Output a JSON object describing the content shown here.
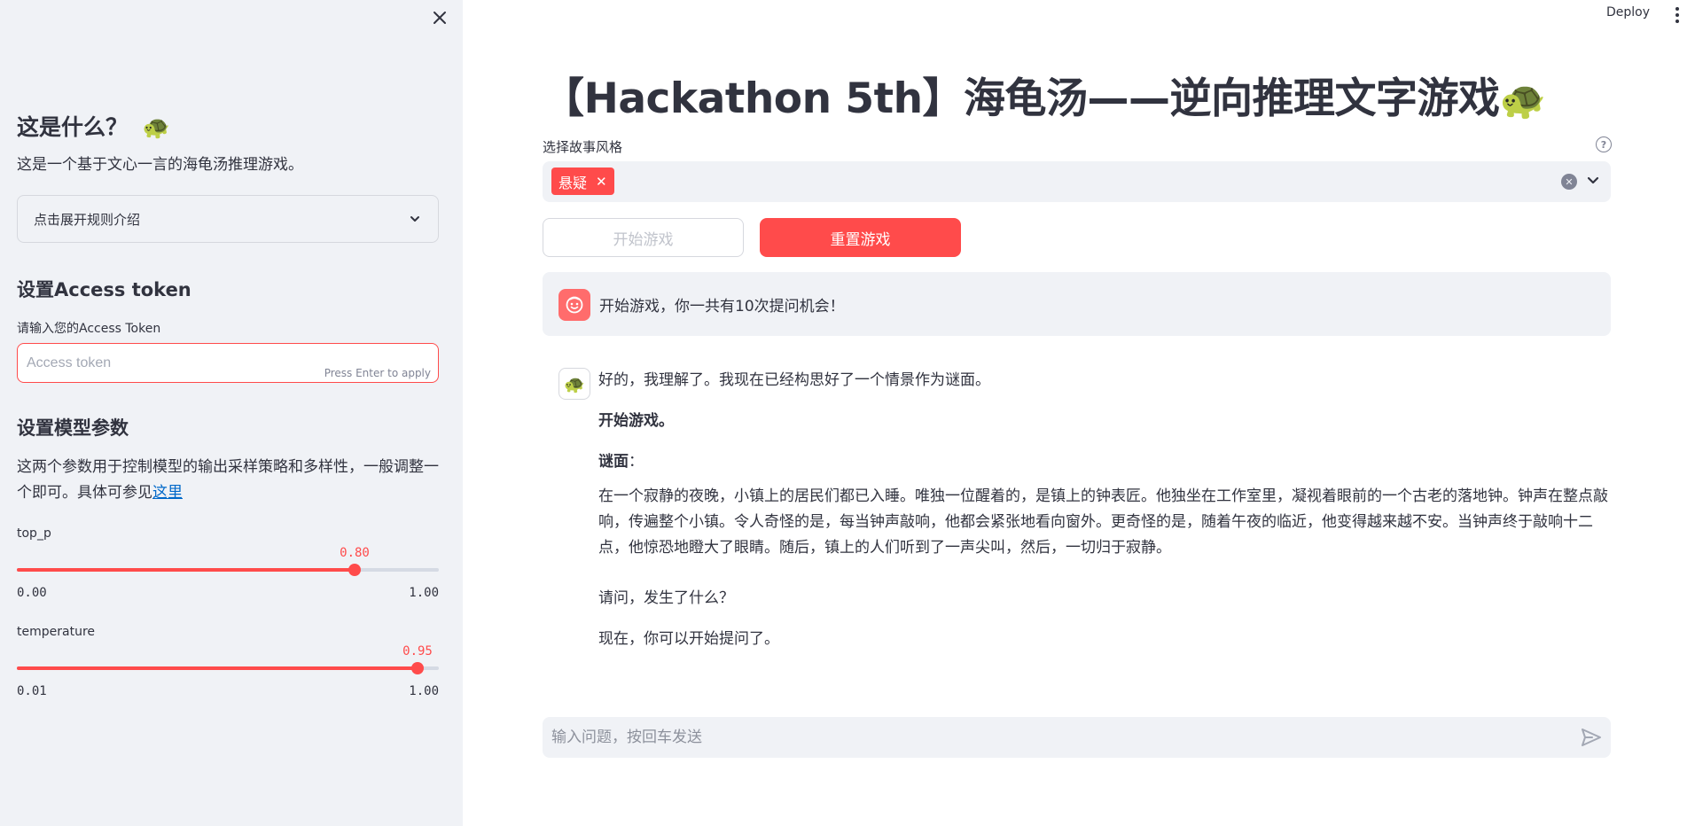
{
  "sidebar": {
    "what_title": "这是什么？",
    "what_emoji": "🐢",
    "what_desc": "这是一个基于文心一言的海龟汤推理游戏。",
    "rules_expander": "点击展开规则介绍",
    "token_heading": "设置Access token",
    "token_label": "请输入您的Access Token",
    "token_placeholder": "Access token",
    "token_value": "",
    "token_hint": "Press Enter to apply",
    "params_heading": "设置模型参数",
    "params_desc_1": "这两个参数用于控制模型的输出采样策略和多样性，一般调整一个即可。具体可参见",
    "params_link": "这里",
    "top_p": {
      "label": "top_p",
      "value": "0.80",
      "min": "0.00",
      "max": "1.00",
      "fraction": 0.8
    },
    "temperature": {
      "label": "temperature",
      "value": "0.95",
      "min": "0.01",
      "max": "1.00",
      "fraction": 0.9495
    }
  },
  "header": {
    "deploy_label": "Deploy",
    "menu_icon": "kebab-menu-icon"
  },
  "main": {
    "title": "【Hackathon 5th】海龟汤——逆向推理文字游戏",
    "title_emoji": "🐢",
    "style_select": {
      "label": "选择故事风格",
      "selected_tag": "悬疑",
      "tag_remove": "✕"
    },
    "start_button": "开始游戏",
    "reset_button": "重置游戏",
    "system_message": "开始游戏，你一共有10次提问机会！",
    "assistant_avatar": "🐢",
    "assistant_message": {
      "line1": "好的，我理解了。我现在已经构思好了一个情景作为谜面。",
      "line2": "开始游戏。",
      "riddle_label": "谜面",
      "riddle_colon": "：",
      "riddle_text": "在一个寂静的夜晚，小镇上的居民们都已入睡。唯独一位醒着的，是镇上的钟表匠。他独坐在工作室里，凝视着眼前的一个古老的落地钟。钟声在整点敲响，传遍整个小镇。令人奇怪的是，每当钟声敲响，他都会紧张地看向窗外。更奇怪的是，随着午夜的临近，他变得越来越不安。当钟声终于敲响十二点，他惊恐地瞪大了眼睛。随后，镇上的人们听到了一声尖叫，然后，一切归于寂静。",
      "question": "请问，发生了什么？",
      "prompt": "现在，你可以开始提问了。"
    },
    "chat_input_placeholder": "输入问题，按回车发送"
  },
  "colors": {
    "accent": "#ff4b4b",
    "sidebar_bg": "#f0f2f6",
    "text": "#31333f",
    "link": "#0068c9"
  }
}
